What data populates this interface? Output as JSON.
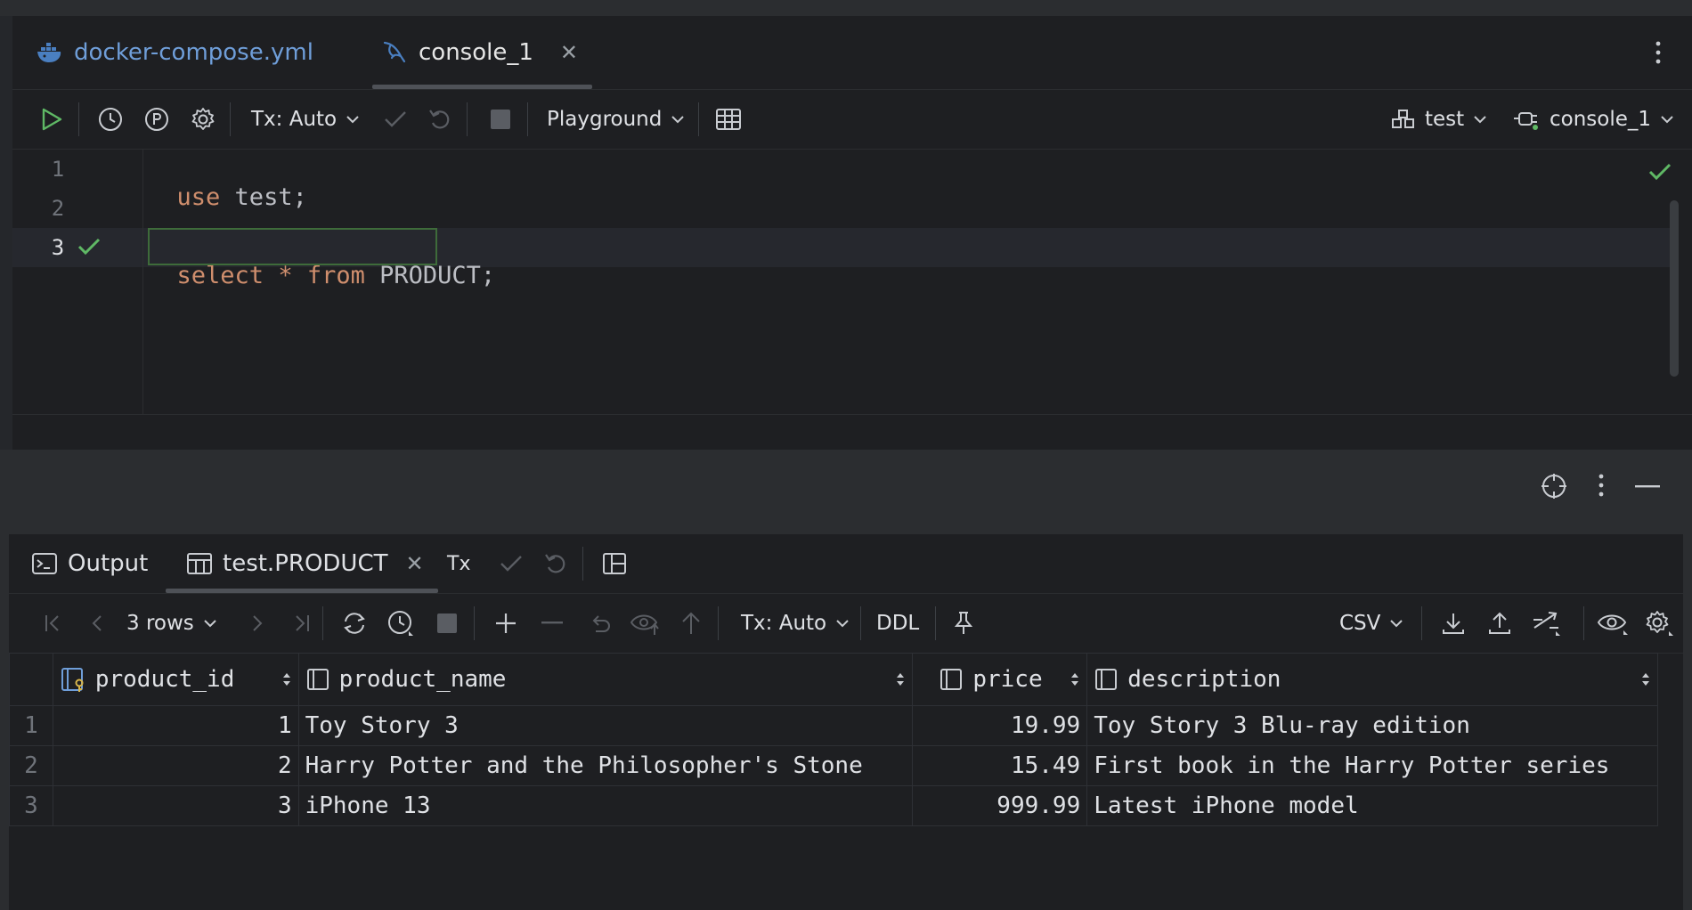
{
  "tabs": [
    {
      "label": "docker-compose.yml",
      "icon": "docker-icon"
    },
    {
      "label": "console_1",
      "icon": "mysql-dolphin-icon",
      "close": "✕"
    }
  ],
  "editor_toolbar": {
    "tx_label": "Tx: Auto",
    "playground_label": "Playground",
    "schema_label": "test",
    "session_label": "console_1"
  },
  "editor": {
    "line_numbers": [
      "1",
      "2",
      "3"
    ],
    "lines": [
      {
        "kw": "use",
        "rest": " test;"
      },
      {
        "kw": "",
        "rest": ""
      },
      {
        "kw": "select",
        "mid": " * ",
        "kw2": "from",
        "rest": " PRODUCT",
        "tail": ";"
      }
    ]
  },
  "results_tabs": {
    "output_label": "Output",
    "table_label": "test.PRODUCT",
    "close": "✕",
    "tx_short": "Tx"
  },
  "results_toolbar": {
    "rows_label": "3 rows",
    "tx_label": "Tx: Auto",
    "ddl_label": "DDL",
    "export_format": "CSV"
  },
  "grid": {
    "columns": [
      "product_id",
      "product_name",
      "price",
      "description"
    ],
    "rows": [
      {
        "n": "1",
        "product_id": "1",
        "product_name": "Toy Story 3",
        "price": "19.99",
        "description": "Toy Story 3 Blu-ray edition"
      },
      {
        "n": "2",
        "product_id": "2",
        "product_name": "Harry Potter and the Philosopher's Stone",
        "price": "15.49",
        "description": "First book in the Harry Potter series"
      },
      {
        "n": "3",
        "product_id": "3",
        "product_name": "iPhone 13",
        "price": "999.99",
        "description": "Latest iPhone model"
      }
    ]
  },
  "colors": {
    "background": "#1e1f22",
    "keyword": "#cf8e6d",
    "success_green": "#5fb865",
    "link_blue": "#6f9ed9"
  }
}
